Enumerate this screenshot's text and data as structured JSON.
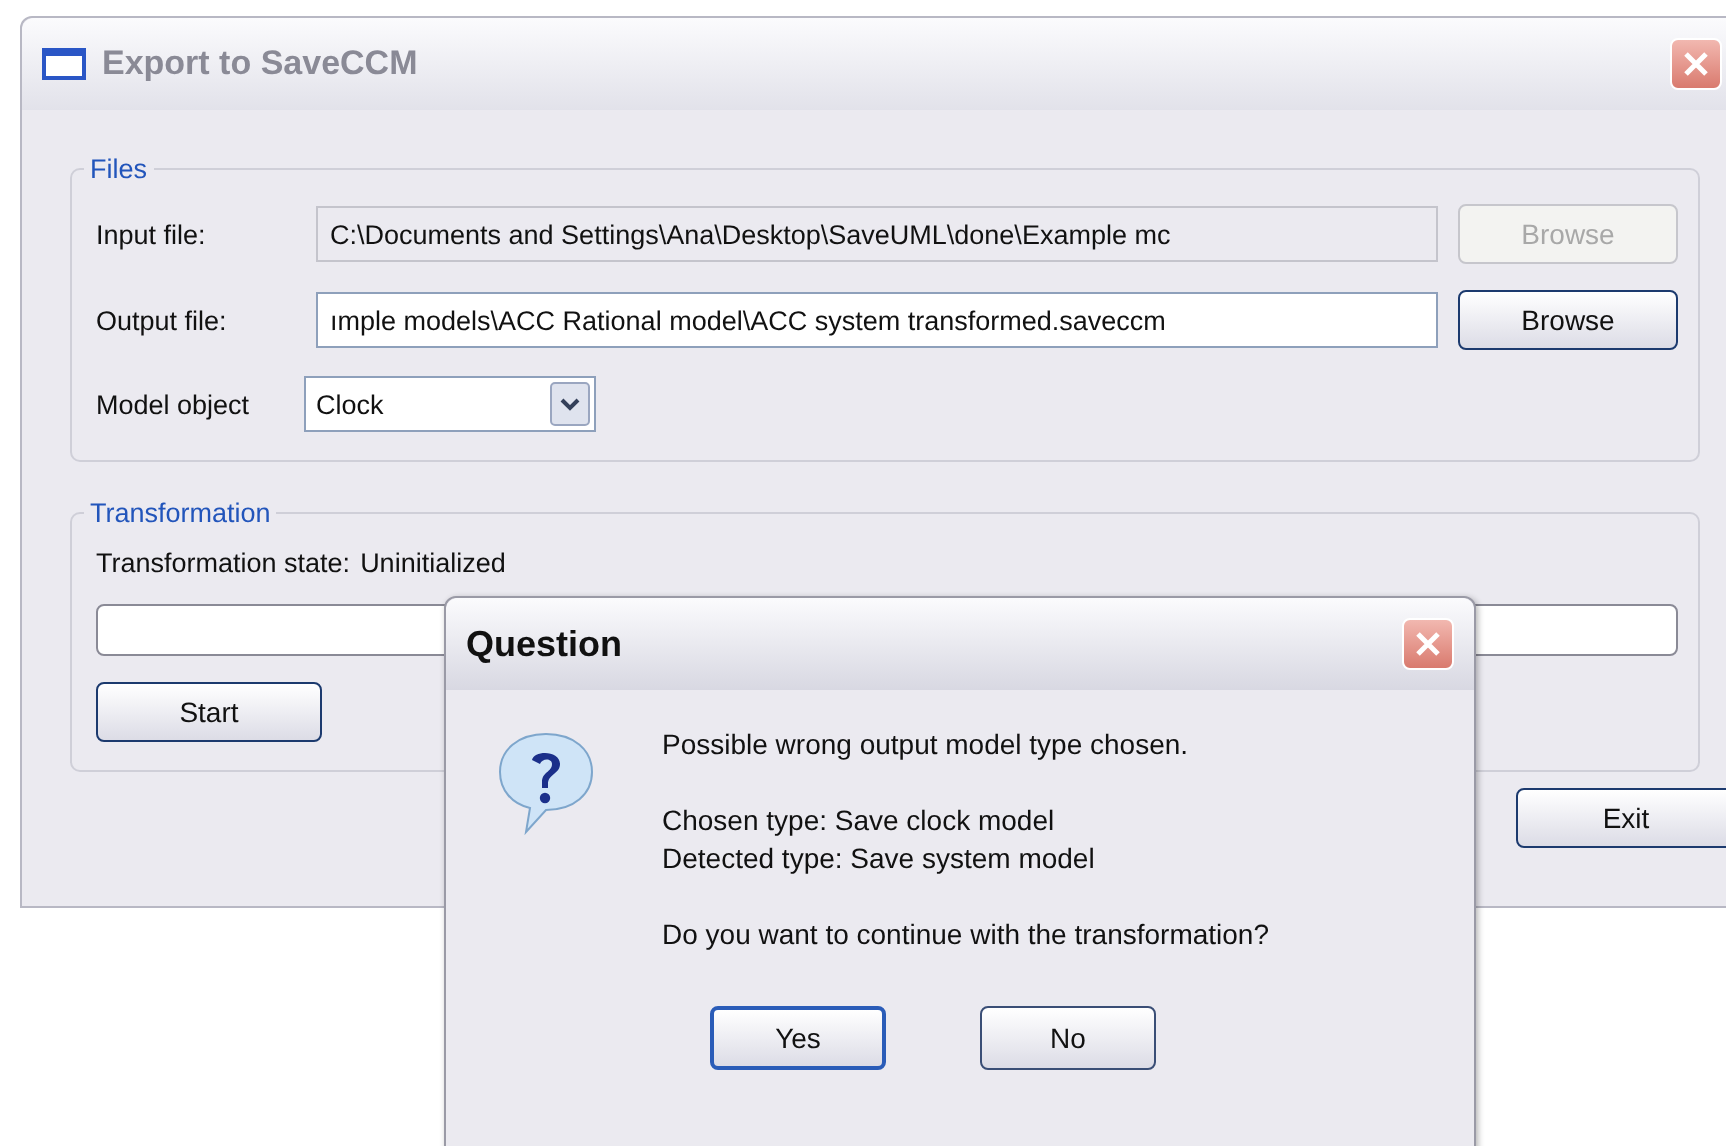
{
  "window": {
    "title": "Export to SaveCCM"
  },
  "files": {
    "title": "Files",
    "input": {
      "label": "Input file:",
      "value": "C:\\Documents and Settings\\Ana\\Desktop\\SaveUML\\done\\Example mc",
      "button": "Browse",
      "disabled": true
    },
    "output": {
      "label": "Output file:",
      "value": "ımple models\\ACC Rational model\\ACC system transformed.saveccm",
      "button": "Browse",
      "disabled": false
    },
    "model": {
      "label": "Model object",
      "value": "Clock"
    }
  },
  "transformation": {
    "title": "Transformation",
    "state_label": "Transformation state:",
    "state_value": "Uninitialized",
    "start": "Start"
  },
  "exit": "Exit",
  "dialog": {
    "title": "Question",
    "paragraphs": [
      [
        "Possible wrong output model type chosen."
      ],
      [
        "Chosen type: Save clock model",
        "Detected type: Save system model"
      ],
      [
        "Do you want to continue with the transformation?"
      ]
    ],
    "buttons": [
      {
        "label": "Yes",
        "selected": true
      },
      {
        "label": "No",
        "selected": false
      }
    ]
  }
}
